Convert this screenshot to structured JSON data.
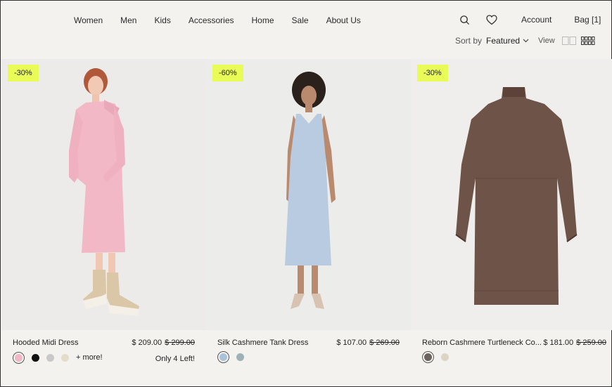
{
  "nav": {
    "links": [
      "Women",
      "Men",
      "Kids",
      "Accessories",
      "Home",
      "Sale",
      "About Us"
    ],
    "account_label": "Account",
    "bag_label": "Bag [1]"
  },
  "sort": {
    "label": "Sort by",
    "value": "Featured",
    "view_label": "View"
  },
  "products": [
    {
      "name": "Hooded Midi Dress",
      "price": "$ 209.00",
      "old_price": "$ 299.00",
      "badge": "-30%",
      "swatches": [
        "#f0b7c6",
        "#111111",
        "#c8c8c8",
        "#e4dccb"
      ],
      "more": "+ more!",
      "stock": "Only 4 Left!",
      "bg": "#ecebea"
    },
    {
      "name": "Silk Cashmere Tank Dress",
      "price": "$ 107.00",
      "old_price": "$ 269.00",
      "badge": "-60%",
      "swatches": [
        "#a9c2d8",
        "#9fb1b5"
      ],
      "more": "",
      "stock": "",
      "bg": "#ececea"
    },
    {
      "name": "Reborn Cashmere Turtleneck Co...",
      "price": "$ 181.00",
      "old_price": "$ 259.00",
      "badge": "-30%",
      "swatches": [
        "#6a6460",
        "#ddd5c4"
      ],
      "more": "",
      "stock": "",
      "bg": "#efeeec"
    }
  ]
}
